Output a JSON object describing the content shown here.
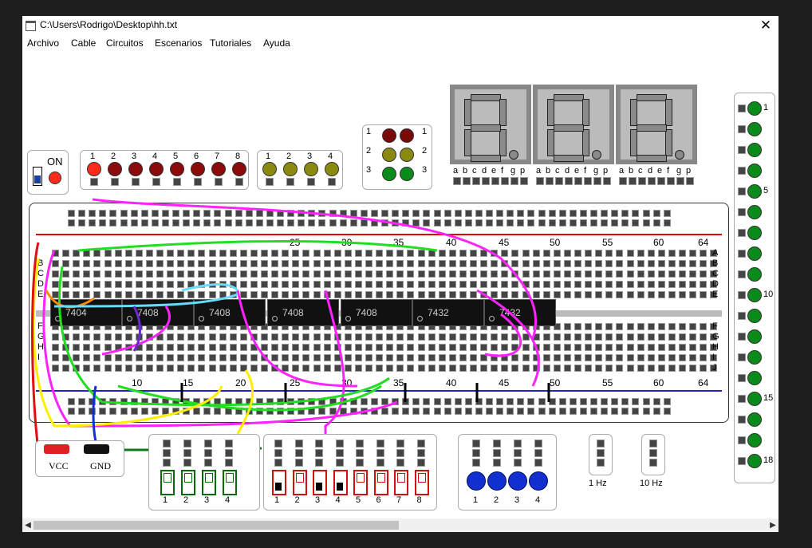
{
  "window": {
    "title": "C:\\Users\\Rodrigo\\Desktop\\hh.txt",
    "close": "✕"
  },
  "menu": [
    "Archivo",
    "Cable",
    "Circuitos",
    "Escenarios",
    "Tutoriales",
    "Ayuda"
  ],
  "power": {
    "label": "ON"
  },
  "red_leds": [
    "1",
    "2",
    "3",
    "4",
    "5",
    "6",
    "7",
    "8"
  ],
  "olive_leds": [
    "1",
    "2",
    "3",
    "4"
  ],
  "tri_leds": {
    "left": [
      "1",
      "2",
      "3"
    ],
    "right": [
      "1",
      "2",
      "3"
    ]
  },
  "seven_seg": {
    "labels": [
      "a",
      "b",
      "c",
      "d",
      "e",
      "f",
      "g",
      "p"
    ]
  },
  "right_leds": {
    "labels": [
      "1",
      "5",
      "10",
      "15",
      "18"
    ]
  },
  "breadboard": {
    "col_labels_top": [
      "25",
      "30",
      "35",
      "40",
      "45",
      "50",
      "55",
      "60",
      "64"
    ],
    "col_labels_bottom": [
      "10",
      "15",
      "20",
      "25",
      "30",
      "35",
      "40",
      "45",
      "50",
      "55",
      "60",
      "64"
    ],
    "rows_left": [
      "B",
      "C",
      "D",
      "E",
      "F",
      "G",
      "H",
      "I"
    ],
    "rows_right": [
      "A",
      "B",
      "C",
      "D",
      "E",
      "F",
      "G",
      "H",
      "I",
      "J"
    ],
    "chips": [
      "7404",
      "7408",
      "7408",
      "7408",
      "7408",
      "7432",
      "7432"
    ]
  },
  "supply": {
    "vcc": "VCC",
    "gnd": "GND"
  },
  "switches_a": [
    "1",
    "2",
    "3",
    "4"
  ],
  "switches_b": [
    "1",
    "2",
    "3",
    "4",
    "5",
    "6",
    "7",
    "8"
  ],
  "buttons": [
    "1",
    "2",
    "3",
    "4"
  ],
  "clocks": [
    "1 Hz",
    "10 Hz"
  ],
  "colors": {
    "red_on": "#ff2a1a",
    "red_off": "#8b0a0a",
    "olive": "#8a8a10",
    "green": "#0a8a1a",
    "wire_magenta": "#ff22ff",
    "seg_gray": "#8a8a8a",
    "button_blue": "#1230d0"
  }
}
